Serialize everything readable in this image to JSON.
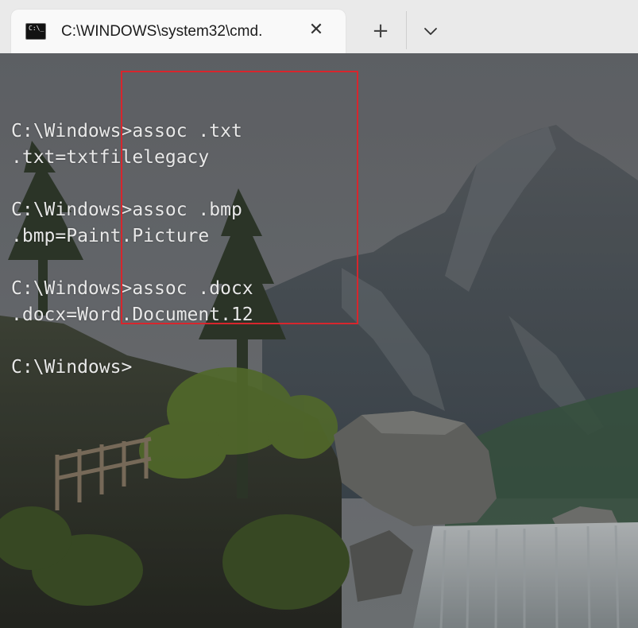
{
  "tab": {
    "title": "C:\\WINDOWS\\system32\\cmd.",
    "icon_prompt": "C:\\_",
    "close_glyph": "✕",
    "new_tab_glyph": "+",
    "dropdown_icon": "chevron-down-icon"
  },
  "terminal": {
    "lines": [
      "",
      "C:\\Windows>assoc .txt",
      ".txt=txtfilelegacy",
      "",
      "C:\\Windows>assoc .bmp",
      ".bmp=Paint.Picture",
      "",
      "C:\\Windows>assoc .docx",
      ".docx=Word.Document.12",
      "",
      "C:\\Windows>"
    ]
  },
  "colors": {
    "highlight_border": "#d7262d",
    "terminal_text": "#e8e8e8",
    "tab_bar": "#eaeaea",
    "tab_active": "#f9f9f9"
  }
}
